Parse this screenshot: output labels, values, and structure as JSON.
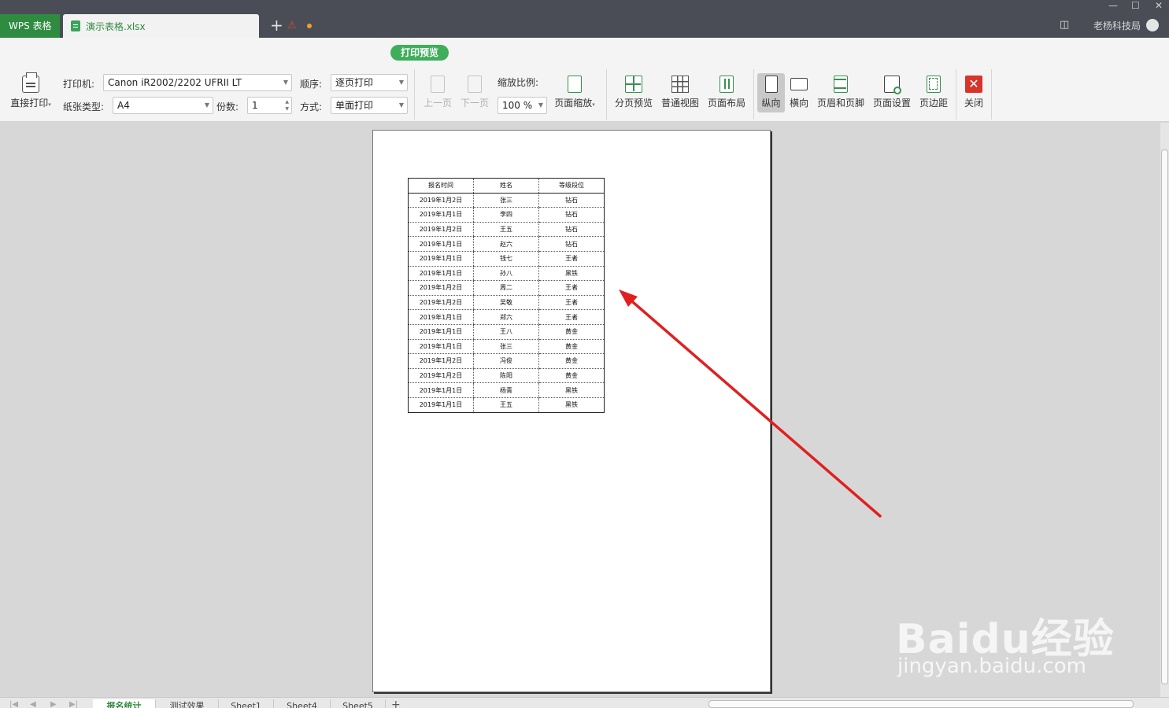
{
  "titlebar": {
    "app_tab": "WPS 表格",
    "doc_tab": "演示表格.xlsx",
    "new_tab": "+",
    "user_name": "老杨科技局"
  },
  "toolbar": {
    "mode": "打印预览",
    "print_direct": "直接打印",
    "printer_label": "打印机:",
    "printer_value": "Canon iR2002/2202 UFRII LT",
    "paper_label": "纸张类型:",
    "paper_value": "A4",
    "copies_label": "份数:",
    "copies_value": "1",
    "order_label": "顺序:",
    "order_value": "逐页打印",
    "mode_label": "方式:",
    "mode_value": "单面打印",
    "prev_page": "上一页",
    "next_page": "下一页",
    "zoom_label": "缩放比例:",
    "zoom_value": "100 %",
    "page_scale": "页面缩放",
    "page_break_preview": "分页预览",
    "normal_view": "普通视图",
    "page_layout": "页面布局",
    "portrait": "纵向",
    "landscape": "横向",
    "header_footer": "页眉和页脚",
    "page_setup": "页面设置",
    "margins": "页边距",
    "close": "关闭"
  },
  "table": {
    "headers": [
      "报名时间",
      "姓名",
      "等级段位"
    ],
    "rows": [
      [
        "2019年1月2日",
        "张三",
        "钻石"
      ],
      [
        "2019年1月1日",
        "李四",
        "钻石"
      ],
      [
        "2019年1月2日",
        "王五",
        "钻石"
      ],
      [
        "2019年1月1日",
        "赵六",
        "钻石"
      ],
      [
        "2019年1月1日",
        "钱七",
        "王者"
      ],
      [
        "2019年1月1日",
        "孙八",
        "黑铁"
      ],
      [
        "2019年1月2日",
        "周二",
        "王者"
      ],
      [
        "2019年1月2日",
        "吴敬",
        "王者"
      ],
      [
        "2019年1月1日",
        "郑六",
        "王者"
      ],
      [
        "2019年1月1日",
        "王八",
        "黄金"
      ],
      [
        "2019年1月1日",
        "张三",
        "黄金"
      ],
      [
        "2019年1月2日",
        "冯俊",
        "黄金"
      ],
      [
        "2019年1月2日",
        "陈阳",
        "黄金"
      ],
      [
        "2019年1月1日",
        "杨青",
        "黑铁"
      ],
      [
        "2019年1月1日",
        "王五",
        "黑铁"
      ]
    ]
  },
  "sheets": [
    "报名统计",
    "测试效果",
    "Sheet1",
    "Sheet4",
    "Sheet5"
  ],
  "watermark": {
    "logo": "Baidu经验",
    "url": "jingyan.baidu.com"
  },
  "colors": {
    "accent": "#2e8b3f",
    "titlebar": "#4a4d56",
    "annotation_arrow": "#e02020"
  }
}
